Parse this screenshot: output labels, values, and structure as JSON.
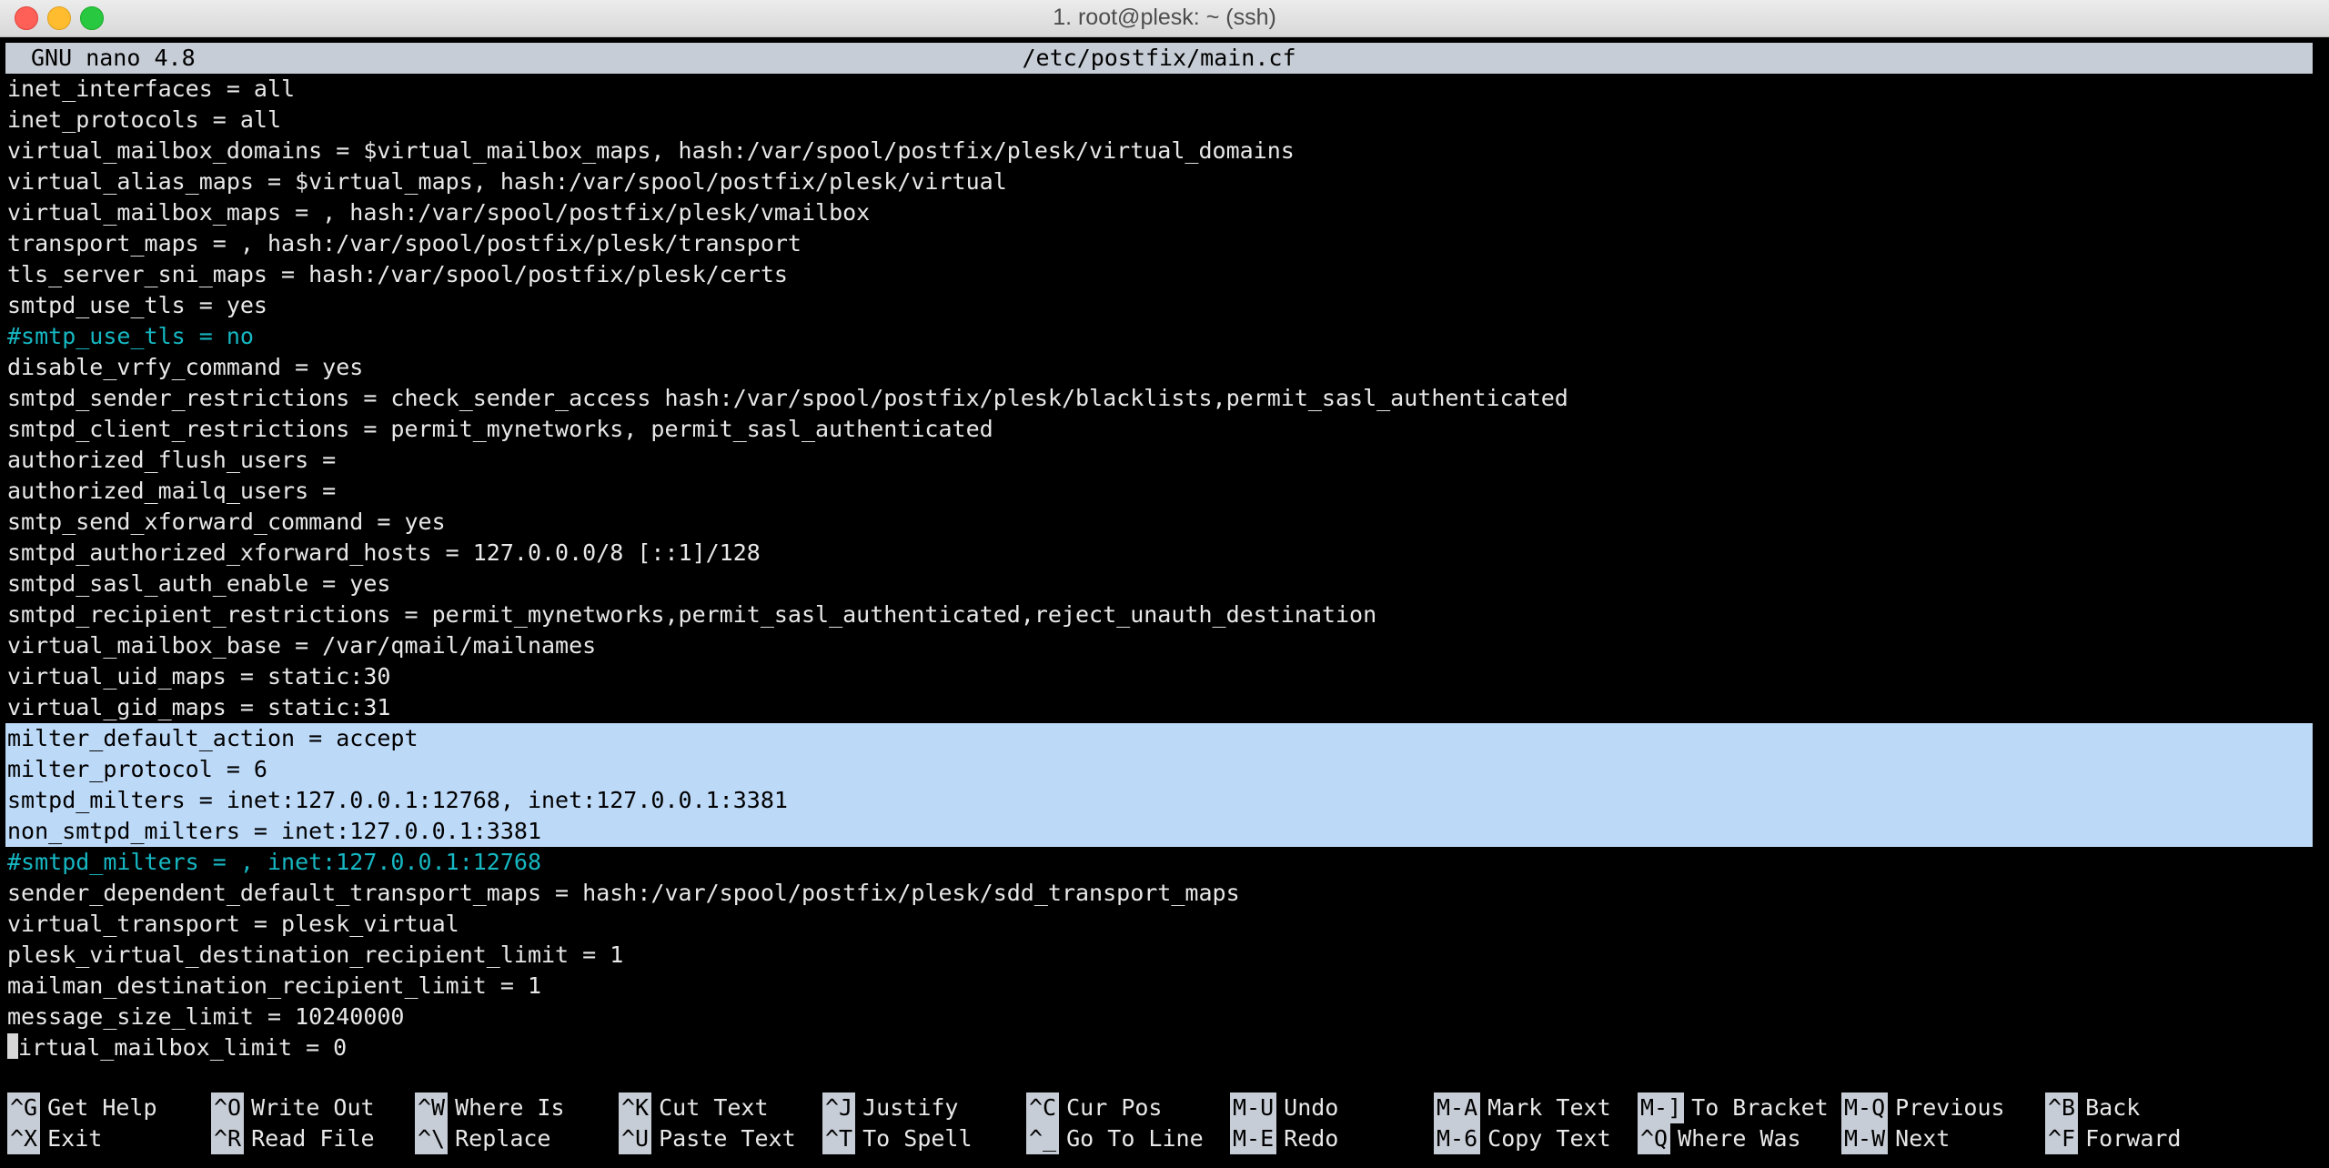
{
  "window": {
    "title": "1. root@plesk: ~ (ssh)"
  },
  "nano": {
    "version": "GNU nano 4.8",
    "filename": "/etc/postfix/main.cf"
  },
  "colors": {
    "comment": "#16b7c2",
    "selection": "#bdd9f8",
    "header_bg": "#c7cdd6"
  },
  "lines": [
    {
      "text": "inet_interfaces = all",
      "type": "normal"
    },
    {
      "text": "inet_protocols = all",
      "type": "normal"
    },
    {
      "text": "virtual_mailbox_domains = $virtual_mailbox_maps, hash:/var/spool/postfix/plesk/virtual_domains",
      "type": "normal"
    },
    {
      "text": "virtual_alias_maps = $virtual_maps, hash:/var/spool/postfix/plesk/virtual",
      "type": "normal"
    },
    {
      "text": "virtual_mailbox_maps = , hash:/var/spool/postfix/plesk/vmailbox",
      "type": "normal"
    },
    {
      "text": "transport_maps = , hash:/var/spool/postfix/plesk/transport",
      "type": "normal"
    },
    {
      "text": "tls_server_sni_maps = hash:/var/spool/postfix/plesk/certs",
      "type": "normal"
    },
    {
      "text": "smtpd_use_tls = yes",
      "type": "normal"
    },
    {
      "text": "#smtp_use_tls = no",
      "type": "comment"
    },
    {
      "text": "disable_vrfy_command = yes",
      "type": "normal"
    },
    {
      "text": "smtpd_sender_restrictions = check_sender_access hash:/var/spool/postfix/plesk/blacklists,permit_sasl_authenticated",
      "type": "normal"
    },
    {
      "text": "smtpd_client_restrictions = permit_mynetworks, permit_sasl_authenticated",
      "type": "normal"
    },
    {
      "text": "authorized_flush_users =",
      "type": "normal"
    },
    {
      "text": "authorized_mailq_users =",
      "type": "normal"
    },
    {
      "text": "smtp_send_xforward_command = yes",
      "type": "normal"
    },
    {
      "text": "smtpd_authorized_xforward_hosts = 127.0.0.0/8 [::1]/128",
      "type": "normal"
    },
    {
      "text": "smtpd_sasl_auth_enable = yes",
      "type": "normal"
    },
    {
      "text": "smtpd_recipient_restrictions = permit_mynetworks,permit_sasl_authenticated,reject_unauth_destination",
      "type": "normal"
    },
    {
      "text": "virtual_mailbox_base = /var/qmail/mailnames",
      "type": "normal"
    },
    {
      "text": "virtual_uid_maps = static:30",
      "type": "normal"
    },
    {
      "text": "virtual_gid_maps = static:31",
      "type": "normal"
    },
    {
      "text": "milter_default_action = accept",
      "type": "selected"
    },
    {
      "text": "milter_protocol = 6",
      "type": "selected"
    },
    {
      "text": "smtpd_milters = inet:127.0.0.1:12768, inet:127.0.0.1:3381",
      "type": "selected"
    },
    {
      "text": "non_smtpd_milters = inet:127.0.0.1:3381",
      "type": "selected"
    },
    {
      "text": "#smtpd_milters = , inet:127.0.0.1:12768",
      "type": "comment"
    },
    {
      "text": "sender_dependent_default_transport_maps = hash:/var/spool/postfix/plesk/sdd_transport_maps",
      "type": "normal"
    },
    {
      "text": "virtual_transport = plesk_virtual",
      "type": "normal"
    },
    {
      "text": "plesk_virtual_destination_recipient_limit = 1",
      "type": "normal"
    },
    {
      "text": "mailman_destination_recipient_limit = 1",
      "type": "normal"
    },
    {
      "text": "message_size_limit = 10240000",
      "type": "normal"
    },
    {
      "text": "irtual_mailbox_limit = 0",
      "type": "cursor"
    }
  ],
  "shortcuts": [
    {
      "key": "^G",
      "label": "Get Help"
    },
    {
      "key": "^X",
      "label": "Exit"
    },
    {
      "key": "^O",
      "label": "Write Out"
    },
    {
      "key": "^R",
      "label": "Read File"
    },
    {
      "key": "^W",
      "label": "Where Is"
    },
    {
      "key": "^\\",
      "label": "Replace"
    },
    {
      "key": "^K",
      "label": "Cut Text"
    },
    {
      "key": "^U",
      "label": "Paste Text"
    },
    {
      "key": "^J",
      "label": "Justify"
    },
    {
      "key": "^T",
      "label": "To Spell"
    },
    {
      "key": "^C",
      "label": "Cur Pos"
    },
    {
      "key": "^_",
      "label": "Go To Line"
    },
    {
      "key": "M-U",
      "label": "Undo"
    },
    {
      "key": "M-E",
      "label": "Redo"
    },
    {
      "key": "M-A",
      "label": "Mark Text"
    },
    {
      "key": "M-6",
      "label": "Copy Text"
    },
    {
      "key": "M-]",
      "label": "To Bracket"
    },
    {
      "key": "^Q",
      "label": "Where Was"
    },
    {
      "key": "M-Q",
      "label": "Previous"
    },
    {
      "key": "M-W",
      "label": "Next"
    },
    {
      "key": "^B",
      "label": "Back"
    },
    {
      "key": "^F",
      "label": "Forward"
    }
  ]
}
